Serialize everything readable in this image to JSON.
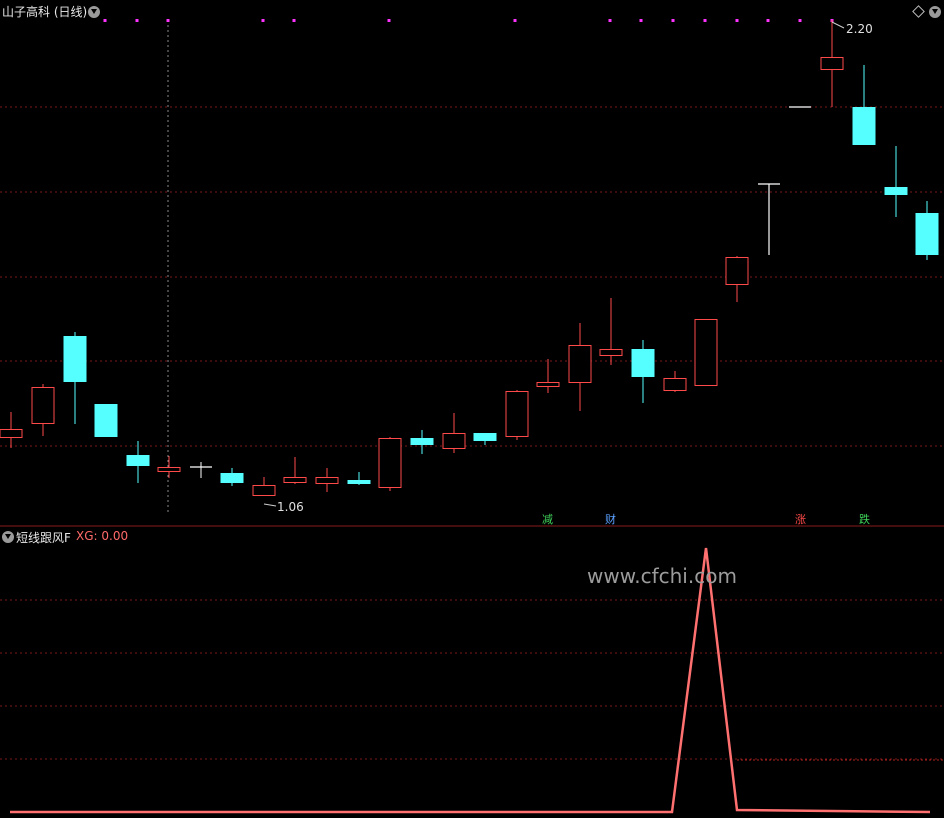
{
  "main_panel": {
    "title": "山子高科 (日线)",
    "high_label": "2.20",
    "low_label": "1.06",
    "signal_tags": [
      {
        "text": "减",
        "color": "#3fd35a"
      },
      {
        "text": "财",
        "color": "#5aa0ff"
      },
      {
        "text": "涨",
        "color": "#ff4a4a"
      },
      {
        "text": "跌",
        "color": "#3fd35a"
      }
    ],
    "colors": {
      "up": "#ff4a4a",
      "down": "#55ffff",
      "dot": "#ff33ff",
      "grid": "#7a1a1a"
    }
  },
  "sub_panel": {
    "title": "短线跟风F",
    "xg_label": "XG: 0.00",
    "line_color": "#ff7070"
  },
  "watermark": "www.cfchi.com"
}
